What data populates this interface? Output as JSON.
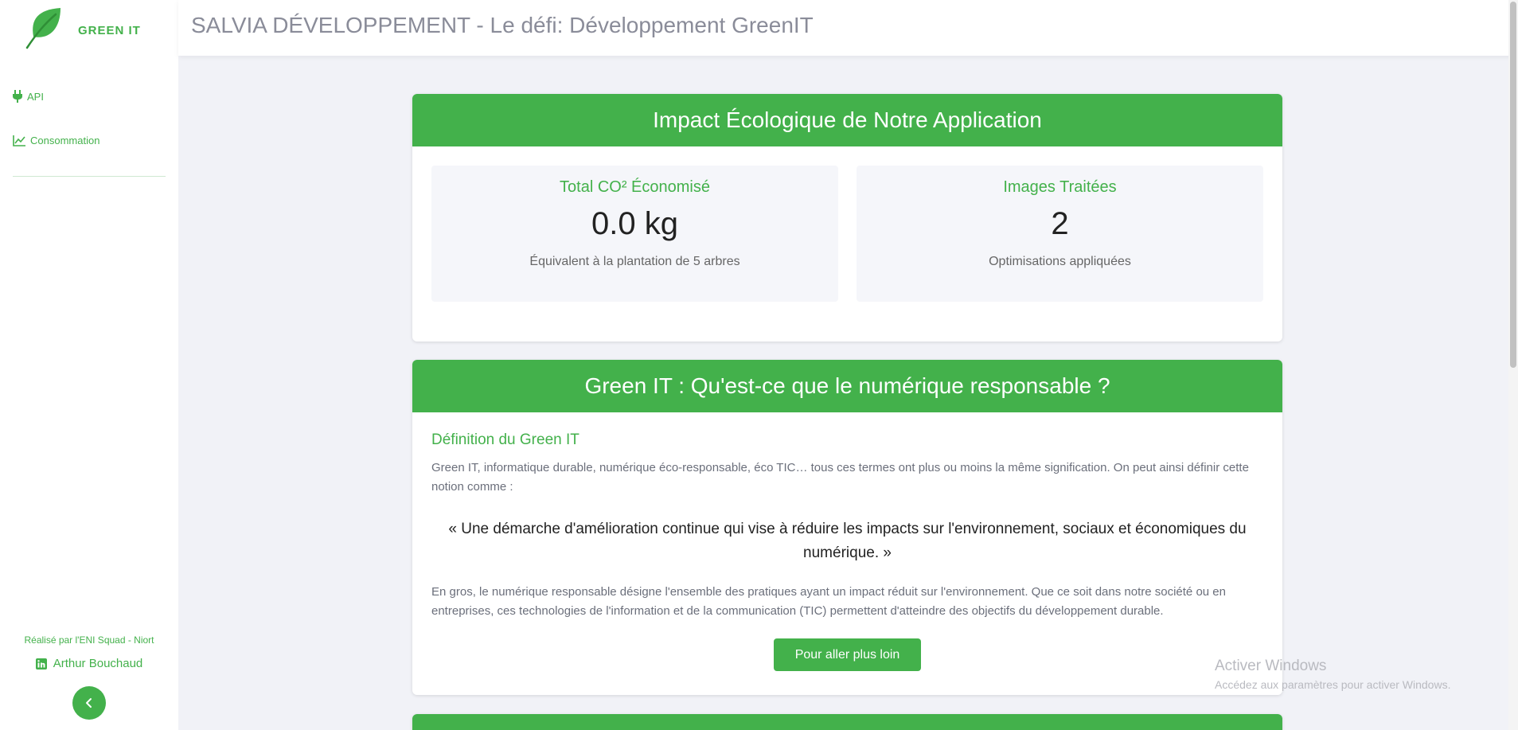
{
  "brand": {
    "name": "GREEN IT"
  },
  "sidebar": {
    "items": [
      {
        "label": "API",
        "icon": "plug-icon"
      },
      {
        "label": "Consommation",
        "icon": "line-chart-icon"
      }
    ],
    "credit": "Réalisé par l'ENI Squad - Niort",
    "author": "Arthur Bouchaud",
    "author_icon": "linkedin-icon",
    "collapse_icon": "chevron-left-icon"
  },
  "header": {
    "title": "SALVIA DÉVELOPPEMENT - Le défi: Développement GreenIT"
  },
  "impact": {
    "title": "Impact Écologique de Notre Application",
    "co2": {
      "label": "Total CO² Économisé",
      "value": "0.0 kg",
      "sub": "Équivalent à la plantation de 5 arbres"
    },
    "images": {
      "label": "Images Traitées",
      "value": "2",
      "sub": "Optimisations appliquées"
    }
  },
  "greenit": {
    "title": "Green IT : Qu'est-ce que le numérique responsable ?",
    "definition_title": "Définition du Green IT",
    "definition_text": "Green IT, informatique durable, numérique éco-responsable, éco TIC… tous ces termes ont plus ou moins la même signification. On peut ainsi définir cette notion comme :",
    "quote": "« Une démarche d'amélioration continue qui vise à réduire les impacts sur l'environnement, sociaux et économiques du numérique. »",
    "summary": "En gros, le numérique responsable désigne l'ensemble des pratiques ayant un impact réduit sur l'environnement. Que ce soit dans notre société ou en entreprises, ces technologies de l'information et de la communication (TIC) permettent d'atteindre des objectifs du développement durable.",
    "button": "Pour aller plus loin"
  },
  "watermark": {
    "title": "Activer Windows",
    "subtitle": "Accédez aux paramètres pour activer Windows."
  },
  "colors": {
    "accent": "#43b14b",
    "background": "#f1f2f7"
  }
}
